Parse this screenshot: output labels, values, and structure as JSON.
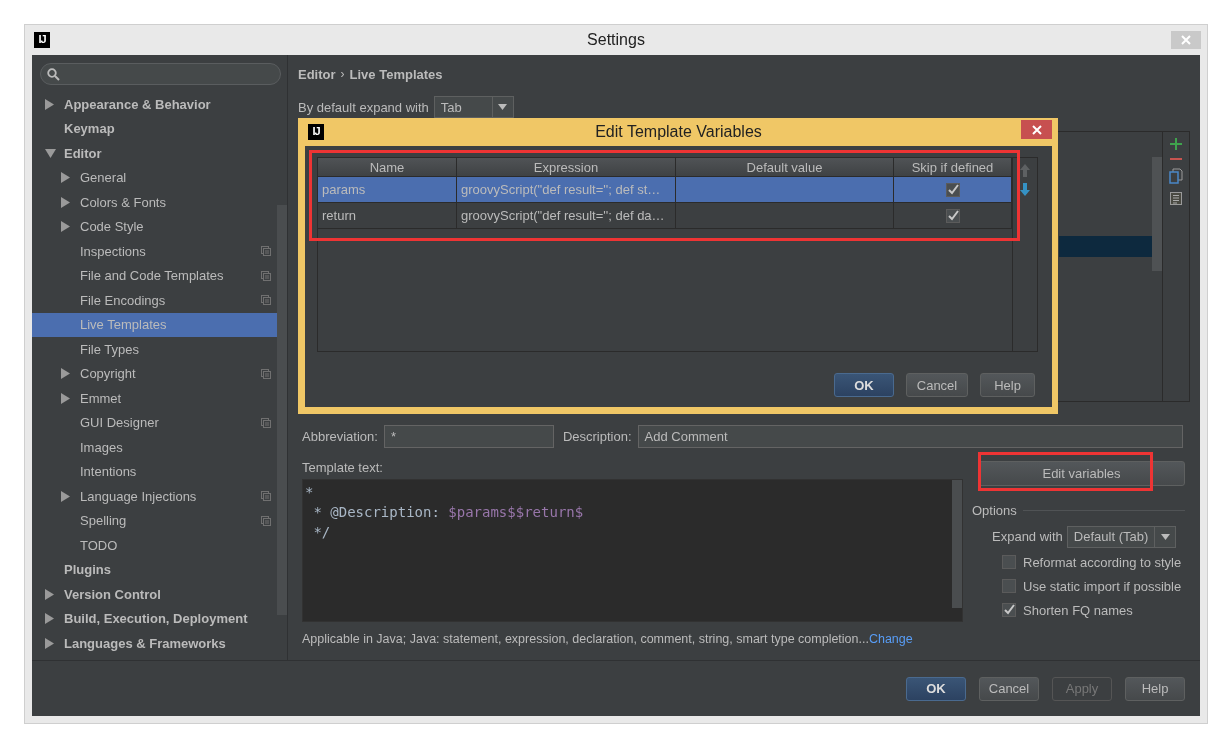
{
  "window": {
    "logo": "IJ",
    "title": "Settings"
  },
  "sidebar": {
    "items": [
      {
        "label": "Appearance & Behavior",
        "expanded": false,
        "selected": false,
        "project_icon": false
      },
      {
        "label": "Keymap",
        "selected": false,
        "project_icon": false
      },
      {
        "label": "Editor",
        "expanded": true,
        "selected": false,
        "project_icon": false,
        "children": [
          {
            "label": "General",
            "expanded": false,
            "selected": false,
            "project_icon": false
          },
          {
            "label": "Colors & Fonts",
            "expanded": false,
            "selected": false,
            "project_icon": false
          },
          {
            "label": "Code Style",
            "expanded": false,
            "selected": false,
            "project_icon": false
          },
          {
            "label": "Inspections",
            "selected": false,
            "project_icon": true
          },
          {
            "label": "File and Code Templates",
            "selected": false,
            "project_icon": true
          },
          {
            "label": "File Encodings",
            "selected": false,
            "project_icon": true
          },
          {
            "label": "Live Templates",
            "selected": true,
            "project_icon": false
          },
          {
            "label": "File Types",
            "selected": false,
            "project_icon": false
          },
          {
            "label": "Copyright",
            "expanded": false,
            "selected": false,
            "project_icon": true
          },
          {
            "label": "Emmet",
            "expanded": false,
            "selected": false,
            "project_icon": false
          },
          {
            "label": "GUI Designer",
            "selected": false,
            "project_icon": true
          },
          {
            "label": "Images",
            "selected": false,
            "project_icon": false
          },
          {
            "label": "Intentions",
            "selected": false,
            "project_icon": false
          },
          {
            "label": "Language Injections",
            "expanded": false,
            "selected": false,
            "project_icon": true
          },
          {
            "label": "Spelling",
            "selected": false,
            "project_icon": true
          },
          {
            "label": "TODO",
            "selected": false,
            "project_icon": false
          }
        ]
      },
      {
        "label": "Plugins",
        "selected": false,
        "project_icon": false
      },
      {
        "label": "Version Control",
        "expanded": false,
        "selected": false,
        "project_icon": false
      },
      {
        "label": "Build, Execution, Deployment",
        "expanded": false,
        "selected": false,
        "project_icon": false
      },
      {
        "label": "Languages & Frameworks",
        "expanded": false,
        "selected": false,
        "project_icon": false
      }
    ]
  },
  "breadcrumb": {
    "items": [
      "Editor",
      "Live Templates"
    ],
    "separator": "›"
  },
  "expand_default": {
    "label": "By default expand with",
    "value": "Tab"
  },
  "dialog": {
    "logo": "IJ",
    "title": "Edit Template Variables",
    "columns": [
      "Name",
      "Expression",
      "Default value",
      "Skip if defined"
    ],
    "rows": [
      {
        "name": "params",
        "expression": "groovyScript(\"def result=''; def st…",
        "skip_if_defined": true,
        "selected": true
      },
      {
        "name": "return",
        "expression": "groovyScript(\"def result=''; def da…",
        "skip_if_defined": true,
        "selected": false
      }
    ],
    "buttons": [
      {
        "label": "OK",
        "default": true
      },
      {
        "label": "Cancel",
        "default": false
      },
      {
        "label": "Help",
        "default": false
      }
    ]
  },
  "abbreviation": {
    "label": "Abbreviation:",
    "value": "*"
  },
  "description": {
    "label": "Description:",
    "value": "Add Comment"
  },
  "template_text": {
    "label": "Template text:",
    "lines": [
      [
        {
          "kind": "text",
          "text": "*"
        }
      ],
      [
        {
          "kind": "text",
          "text": " * @Description: "
        },
        {
          "kind": "variable",
          "text": "$params$"
        },
        {
          "kind": "variable",
          "text": "$return$"
        }
      ],
      [
        {
          "kind": "text",
          "text": " */"
        }
      ]
    ]
  },
  "applicable": {
    "text": "Applicable in Java; Java: statement, expression, declaration, comment, string, smart type completion...",
    "link": "Change"
  },
  "edit_variables_button": "Edit variables",
  "options": {
    "title": "Options",
    "expand_with": {
      "label": "Expand with",
      "value": "Default (Tab)"
    },
    "checkboxes": [
      {
        "label": "Reformat according to style",
        "checked": false
      },
      {
        "label": "Use static import if possible",
        "checked": false
      },
      {
        "label": "Shorten FQ names",
        "checked": true
      }
    ]
  },
  "buttons": [
    {
      "label": "OK",
      "default": true,
      "disabled": false
    },
    {
      "label": "Cancel",
      "default": false,
      "disabled": false
    },
    {
      "label": "Apply",
      "default": false,
      "disabled": true
    },
    {
      "label": "Help",
      "default": false,
      "disabled": false
    }
  ]
}
